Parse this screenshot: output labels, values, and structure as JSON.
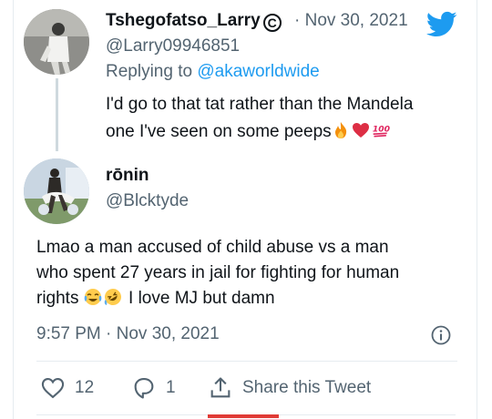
{
  "tweet_parent": {
    "display_name": "Tshegofatso_Larry",
    "verified_glyph": "C",
    "date": "· Nov 30, 2021",
    "handle": "@Larry09946851",
    "replying_prefix": "Replying to",
    "replying_mention": "@akaworldwide",
    "text_line1": "I'd go to that tat rather than the Mandela",
    "text_line2": "one I've seen on some peeps",
    "emojis": [
      "fire-emoji",
      "heart-emoji",
      "hundred-emoji"
    ]
  },
  "tweet_main": {
    "display_name": "rōnin",
    "handle": "@Blcktyde",
    "text_line1": "Lmao a man accused of child abuse vs a man",
    "text_line2": "who spent 27 years in jail for fighting for human",
    "text_line3_prefix": "rights",
    "text_line3_suffix": "I love MJ but damn",
    "emojis": [
      "tears-of-joy-emoji",
      "rolling-on-floor-laughing-emoji"
    ],
    "timestamp": "9:57 PM · Nov 30, 2021"
  },
  "actions": {
    "likes": "12",
    "replies": "1",
    "share_label": "Share this Tweet"
  },
  "colors": {
    "twitter_blue": "#1d9bf0",
    "text_secondary": "#536471",
    "heart_red": "#e0245e",
    "accent_red": "#e03a35"
  }
}
